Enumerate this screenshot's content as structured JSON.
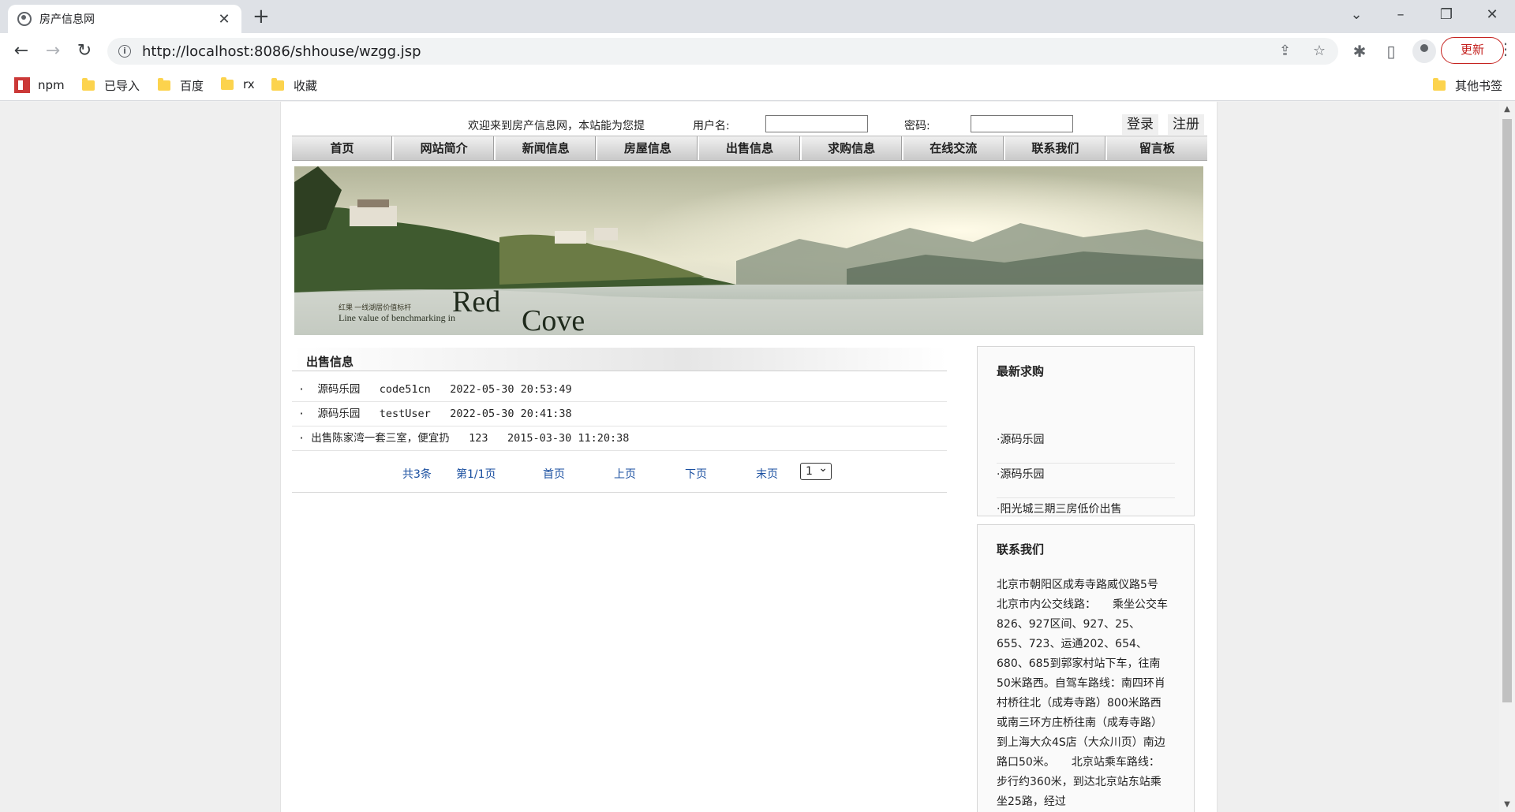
{
  "browser": {
    "tab_title": "房产信息网",
    "url": "http://localhost:8086/shhouse/wzgg.jsp",
    "update_label": "更新",
    "bookmarks": [
      "npm",
      "已导入",
      "百度",
      "rx",
      "收藏"
    ],
    "other_bookmarks": "其他书签"
  },
  "header": {
    "welcome": "欢迎来到房产信息网，本站能为您提",
    "username_label": "用户名:",
    "password_label": "密码:",
    "login_label": "登录",
    "register_label": "注册"
  },
  "nav": [
    "首页",
    "网站简介",
    "新闻信息",
    "房屋信息",
    "出售信息",
    "求购信息",
    "在线交流",
    "联系我们",
    "留言板"
  ],
  "banner": {
    "slogan": "红果 一线湖居价值标杆",
    "tagline": "Line value of benchmarking in",
    "brand_red": "Red",
    "brand_cove": "Cove"
  },
  "main": {
    "section_title": "出售信息",
    "rows": [
      {
        "title": "源码乐园",
        "user": "code51cn",
        "time": "2022-05-30 20:53:49"
      },
      {
        "title": "源码乐园",
        "user": "testUser",
        "time": "2022-05-30 20:41:38"
      },
      {
        "title": "出售陈家湾一套三室，便宜扔",
        "user": "123",
        "time": "2015-03-30 11:20:38"
      }
    ],
    "pager": {
      "total": "共3条",
      "page": "第1/1页",
      "first": "首页",
      "prev": "上页",
      "next": "下页",
      "last": "末页",
      "select_value": "1"
    }
  },
  "sidebar": {
    "latest_title": "最新求购",
    "latest_items": [
      "·源码乐园",
      "·源码乐园",
      "·阳光城三期三房低价出售"
    ],
    "contact_title": "联系我们",
    "contact_text": "北京市朝阳区成寿寺路威仪路5号　　北京市内公交线路：　　乘坐公交车826、927区间、927、25、655、723、运通202、654、680、685到郭家村站下车，往南50米路西。自驾车路线：南四环肖村桥往北（成寿寺路）800米路西或南三环方庄桥往南（成寿寺路）到上海大众4S店（大众川页）南边路口50米。　　北京站乘车路线：　　步行约360米，到达北京站东站乘坐25路，经过"
  }
}
